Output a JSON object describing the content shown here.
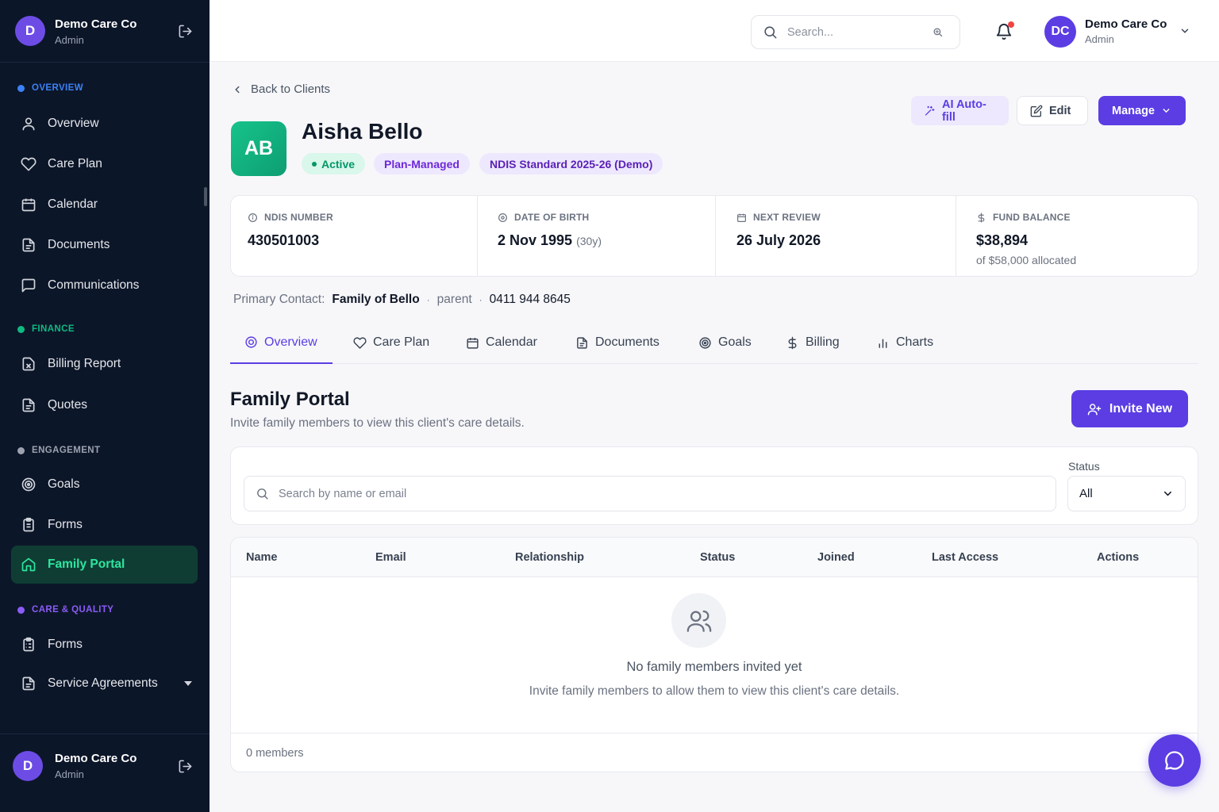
{
  "sidebar": {
    "org_name": "Demo Care Co",
    "org_role": "Admin",
    "avatar_initial": "D",
    "sections": {
      "overview": {
        "label": "OVERVIEW",
        "color": "#3b82f6"
      },
      "finance": {
        "label": "FINANCE",
        "color": "#10b981"
      },
      "engagement": {
        "label": "ENGAGEMENT",
        "color": "#9ca3af"
      },
      "care_quality": {
        "label": "CARE & QUALITY",
        "color": "#8b5cf6"
      }
    },
    "items": {
      "overview": "Overview",
      "care_plan": "Care Plan",
      "calendar": "Calendar",
      "documents": "Documents",
      "communications": "Communications",
      "billing_report": "Billing Report",
      "quotes": "Quotes",
      "goals": "Goals",
      "forms": "Forms",
      "family_portal": "Family Portal",
      "forms2": "Forms",
      "service_agreements": "Service Agreements"
    },
    "active_item": "family_portal",
    "footer": {
      "org_name": "Demo Care Co",
      "org_role": "Admin",
      "avatar_initial": "D"
    }
  },
  "header": {
    "search_placeholder": "Search...",
    "notifications_unread": true,
    "user_initials": "DC",
    "user_name": "Demo Care Co",
    "user_role": "Admin"
  },
  "client": {
    "back_label": "Back to Clients",
    "initials": "AB",
    "name": "Aisha Bello",
    "badges": {
      "status": "Active",
      "plan": "Plan-Managed",
      "standard": "NDIS Standard 2025-26 (Demo)"
    },
    "actions": {
      "autofill": "AI Auto-fill",
      "edit": "Edit",
      "manage": "Manage"
    },
    "info": {
      "ndis_label": "NDIS NUMBER",
      "ndis_value": "430501003",
      "dob_label": "DATE OF BIRTH",
      "dob_value": "2 Nov 1995",
      "dob_age": "(30y)",
      "review_label": "NEXT REVIEW",
      "review_value": "26 July 2026",
      "fund_label": "FUND BALANCE",
      "fund_value": "$38,894",
      "fund_sub": "of $58,000 allocated"
    },
    "contact": {
      "label": "Primary Contact:",
      "name": "Family of Bello",
      "relation": "parent",
      "phone": "0411 944 8645"
    }
  },
  "tabs": {
    "overview": "Overview",
    "care_plan": "Care Plan",
    "calendar": "Calendar",
    "documents": "Documents",
    "goals": "Goals",
    "billing": "Billing",
    "charts": "Charts",
    "active": "overview"
  },
  "portal": {
    "title": "Family Portal",
    "subtitle": "Invite family members to view this client's care details.",
    "invite_label": "Invite New",
    "search_placeholder": "Search by name or email",
    "status_label": "Status",
    "status_value": "All",
    "columns": [
      "Name",
      "Email",
      "Relationship",
      "Status",
      "Joined",
      "Last Access",
      "Actions"
    ],
    "rows": [],
    "empty_title": "No family members invited yet",
    "empty_sub": "Invite family members to allow them to view this client's care details.",
    "footer_count": "0 members"
  }
}
